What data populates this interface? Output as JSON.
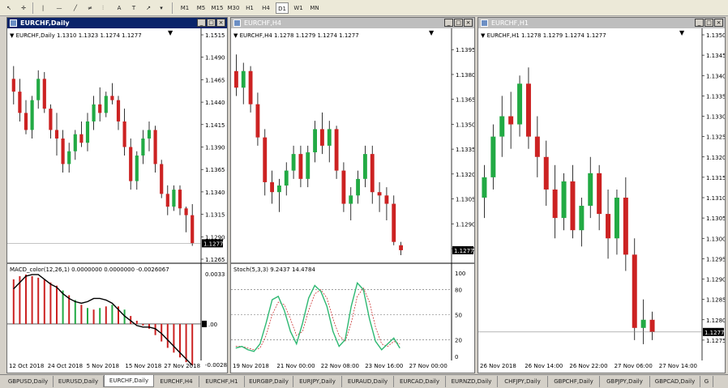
{
  "toolbar": {
    "timeframes": [
      "M1",
      "M5",
      "M15",
      "M30",
      "H1",
      "H4",
      "D1",
      "W1",
      "MN"
    ],
    "active_timeframe": "D1"
  },
  "windows": [
    {
      "title": "EURCHF,Daily",
      "active": true,
      "chart_label": "EURCHF,Daily  1.1310 1.1323 1.1274 1.1277",
      "indicator_label": "MACD_color(12,26,1) 0.0000000 0.0000000 -0.0026067",
      "current_price": "1.1277",
      "macd_axis": [
        "0.0033",
        ".00",
        "-0.0028"
      ]
    },
    {
      "title": "EURCHF,H4",
      "active": false,
      "chart_label": "EURCHF,H4  1.1278 1.1279 1.1274 1.1277",
      "indicator_label": "Stoch(5,3,3) 9.2437 14.4784",
      "current_price": "1.1277",
      "stoch_levels": [
        "100",
        "80",
        "50",
        "20",
        "0"
      ]
    },
    {
      "title": "EURCHF,H1",
      "active": false,
      "chart_label": "EURCHF,H1  1.1278 1.1279 1.1274 1.1277",
      "current_price": "1.1277"
    }
  ],
  "chart_data": [
    {
      "type": "candlestick",
      "title": "EURCHF,Daily",
      "ylim": [
        1.1265,
        1.1515
      ],
      "ticks": [
        "1.1515",
        "1.1490",
        "1.1465",
        "1.1440",
        "1.1415",
        "1.1390",
        "1.1365",
        "1.1340",
        "1.1315",
        "1.1290",
        "1.1265"
      ],
      "x_labels": [
        "12 Oct 2018",
        "24 Oct 2018",
        "5 Nov 2018",
        "15 Nov 2018",
        "27 Nov 2018"
      ],
      "candles": [
        [
          1.147,
          1.1485,
          1.144,
          1.1455
        ],
        [
          1.1455,
          1.147,
          1.142,
          1.143
        ],
        [
          1.143,
          1.1445,
          1.1405,
          1.141
        ],
        [
          1.141,
          1.145,
          1.14,
          1.1445
        ],
        [
          1.1445,
          1.148,
          1.1435,
          1.147
        ],
        [
          1.147,
          1.1478,
          1.143,
          1.1435
        ],
        [
          1.1435,
          1.144,
          1.14,
          1.141
        ],
        [
          1.141,
          1.143,
          1.138,
          1.14
        ],
        [
          1.14,
          1.141,
          1.136,
          1.137
        ],
        [
          1.137,
          1.1395,
          1.136,
          1.1385
        ],
        [
          1.1385,
          1.141,
          1.1375,
          1.1405
        ],
        [
          1.1405,
          1.142,
          1.139,
          1.1395
        ],
        [
          1.1395,
          1.143,
          1.1385,
          1.142
        ],
        [
          1.142,
          1.145,
          1.141,
          1.144
        ],
        [
          1.144,
          1.146,
          1.142,
          1.143
        ],
        [
          1.143,
          1.1455,
          1.1425,
          1.145
        ],
        [
          1.145,
          1.1465,
          1.144,
          1.1445
        ],
        [
          1.1445,
          1.145,
          1.141,
          1.142
        ],
        [
          1.142,
          1.1435,
          1.138,
          1.139
        ],
        [
          1.139,
          1.14,
          1.134,
          1.135
        ],
        [
          1.135,
          1.1385,
          1.134,
          1.138
        ],
        [
          1.138,
          1.141,
          1.137,
          1.14
        ],
        [
          1.14,
          1.142,
          1.1385,
          1.141
        ],
        [
          1.141,
          1.1415,
          1.136,
          1.137
        ],
        [
          1.137,
          1.1375,
          1.133,
          1.1335
        ],
        [
          1.1335,
          1.1345,
          1.131,
          1.132
        ],
        [
          1.132,
          1.1345,
          1.1315,
          1.134
        ],
        [
          1.134,
          1.1345,
          1.131,
          1.1318
        ],
        [
          1.1318,
          1.132,
          1.129,
          1.131
        ],
        [
          1.131,
          1.1323,
          1.1274,
          1.1277
        ]
      ]
    },
    {
      "type": "bar",
      "title": "MACD_color(12,26,1)",
      "ylim": [
        -0.0028,
        0.0033
      ],
      "histogram": [
        0.0028,
        0.003,
        0.0031,
        0.003,
        0.0029,
        0.0028,
        0.0026,
        0.0024,
        0.0021,
        0.0018,
        0.0015,
        0.0012,
        0.001,
        0.0009,
        0.001,
        0.0011,
        0.0012,
        0.0011,
        0.0009,
        0.0005,
        0.0002,
        -0.0001,
        -0.0003,
        -0.0007,
        -0.0011,
        -0.0015,
        -0.0018,
        -0.0021,
        -0.0024,
        -0.0026
      ],
      "signal": [
        0.0022,
        0.0026,
        0.003,
        0.0031,
        0.0031,
        0.0028,
        0.0025,
        0.0023,
        0.0019,
        0.0016,
        0.0014,
        0.0013,
        0.0014,
        0.0016,
        0.0016,
        0.0015,
        0.0013,
        0.0009,
        0.0005,
        0.0002,
        -0.0001,
        -0.0002,
        -0.0002,
        -0.0003,
        -0.0006,
        -0.001,
        -0.0014,
        -0.0018,
        -0.0022,
        -0.0026
      ]
    },
    {
      "type": "candlestick",
      "title": "EURCHF,H4",
      "ylim": [
        1.1275,
        1.14
      ],
      "ticks": [
        "1.1395",
        "1.1380",
        "1.1365",
        "1.1350",
        "1.1335",
        "1.1320",
        "1.1305",
        "1.1290",
        "1.1275"
      ],
      "x_labels": [
        "19 Nov 2018",
        "21 Nov 00:00",
        "22 Nov 08:00",
        "23 Nov 16:00",
        "27 Nov 00:00"
      ],
      "candles": [
        [
          1.1385,
          1.1395,
          1.137,
          1.1375
        ],
        [
          1.1375,
          1.139,
          1.1365,
          1.1385
        ],
        [
          1.1385,
          1.1388,
          1.136,
          1.1365
        ],
        [
          1.1365,
          1.1372,
          1.134,
          1.1345
        ],
        [
          1.1345,
          1.135,
          1.131,
          1.1318
        ],
        [
          1.1318,
          1.1325,
          1.1305,
          1.1312
        ],
        [
          1.1312,
          1.132,
          1.13,
          1.1316
        ],
        [
          1.1316,
          1.133,
          1.131,
          1.1325
        ],
        [
          1.1325,
          1.134,
          1.132,
          1.1335
        ],
        [
          1.1335,
          1.134,
          1.1315,
          1.132
        ],
        [
          1.132,
          1.134,
          1.1315,
          1.1336
        ],
        [
          1.1336,
          1.1355,
          1.133,
          1.135
        ],
        [
          1.135,
          1.136,
          1.1335,
          1.134
        ],
        [
          1.134,
          1.1355,
          1.133,
          1.135
        ],
        [
          1.135,
          1.1352,
          1.132,
          1.1325
        ],
        [
          1.1325,
          1.133,
          1.13,
          1.1305
        ],
        [
          1.1305,
          1.1315,
          1.1295,
          1.131
        ],
        [
          1.131,
          1.1325,
          1.1305,
          1.132
        ],
        [
          1.132,
          1.134,
          1.1315,
          1.1335
        ],
        [
          1.1335,
          1.134,
          1.1305,
          1.1312
        ],
        [
          1.1312,
          1.1318,
          1.13,
          1.131
        ],
        [
          1.131,
          1.1315,
          1.1295,
          1.1305
        ],
        [
          1.1305,
          1.131,
          1.128,
          1.1282
        ],
        [
          1.128,
          1.1282,
          1.1274,
          1.1277
        ]
      ]
    },
    {
      "type": "line",
      "title": "Stoch(5,3,3)",
      "ylim": [
        0,
        100
      ],
      "main": [
        10,
        12,
        8,
        6,
        15,
        40,
        68,
        72,
        55,
        30,
        15,
        40,
        70,
        85,
        78,
        60,
        30,
        12,
        20,
        60,
        88,
        80,
        45,
        18,
        8,
        15,
        22,
        10
      ],
      "signal": [
        12,
        12,
        10,
        8,
        10,
        25,
        50,
        65,
        62,
        45,
        25,
        30,
        55,
        75,
        80,
        70,
        45,
        25,
        18,
        40,
        72,
        82,
        65,
        35,
        15,
        12,
        18,
        15
      ]
    },
    {
      "type": "candlestick",
      "title": "EURCHF,H1",
      "ylim": [
        1.127,
        1.135
      ],
      "ticks": [
        "1.1350",
        "1.1345",
        "1.1340",
        "1.1335",
        "1.1330",
        "1.1325",
        "1.1320",
        "1.1315",
        "1.1310",
        "1.1305",
        "1.1300",
        "1.1295",
        "1.1290",
        "1.1285",
        "1.1280",
        "1.1275"
      ],
      "x_labels": [
        "26 Nov 2018",
        "26 Nov 14:00",
        "26 Nov 22:00",
        "27 Nov 06:00",
        "27 Nov 14:00"
      ],
      "candles": [
        [
          1.131,
          1.1318,
          1.1305,
          1.1315
        ],
        [
          1.1315,
          1.1328,
          1.1312,
          1.1325
        ],
        [
          1.1325,
          1.1335,
          1.132,
          1.133
        ],
        [
          1.133,
          1.1336,
          1.1322,
          1.1328
        ],
        [
          1.1328,
          1.134,
          1.1325,
          1.1338
        ],
        [
          1.1338,
          1.1342,
          1.1322,
          1.1325
        ],
        [
          1.1325,
          1.133,
          1.1315,
          1.132
        ],
        [
          1.132,
          1.1324,
          1.1308,
          1.1312
        ],
        [
          1.1312,
          1.1318,
          1.13,
          1.1305
        ],
        [
          1.1305,
          1.1316,
          1.1302,
          1.1314
        ],
        [
          1.1314,
          1.1318,
          1.13,
          1.1302
        ],
        [
          1.1302,
          1.131,
          1.1298,
          1.1308
        ],
        [
          1.1308,
          1.132,
          1.1305,
          1.1316
        ],
        [
          1.1316,
          1.1318,
          1.1302,
          1.1306
        ],
        [
          1.1306,
          1.1312,
          1.1295,
          1.13
        ],
        [
          1.13,
          1.1312,
          1.1296,
          1.131
        ],
        [
          1.131,
          1.1315,
          1.1292,
          1.1296
        ],
        [
          1.1296,
          1.13,
          1.1275,
          1.1278
        ],
        [
          1.1278,
          1.1285,
          1.1274,
          1.128
        ],
        [
          1.128,
          1.1282,
          1.1275,
          1.1277
        ]
      ]
    }
  ],
  "tabs": [
    "GBPUSD,Daily",
    "EURUSD,Daily",
    "EURCHF,Daily",
    "EURCHF,H4",
    "EURCHF,H1",
    "EURGBP,Daily",
    "EURJPY,Daily",
    "EURAUD,Daily",
    "EURCAD,Daily",
    "EURNZD,Daily",
    "CHFJPY,Daily",
    "GBPCHF,Daily",
    "GBPJPY,Daily",
    "GBPCAD,Daily",
    "G"
  ],
  "active_tab": "EURCHF,Daily",
  "colors": {
    "bull": "#22aa44",
    "bear": "#cc2222",
    "stoch_main": "#2eb872",
    "stoch_signal": "#cc3333",
    "active_title": "#0a246a"
  }
}
